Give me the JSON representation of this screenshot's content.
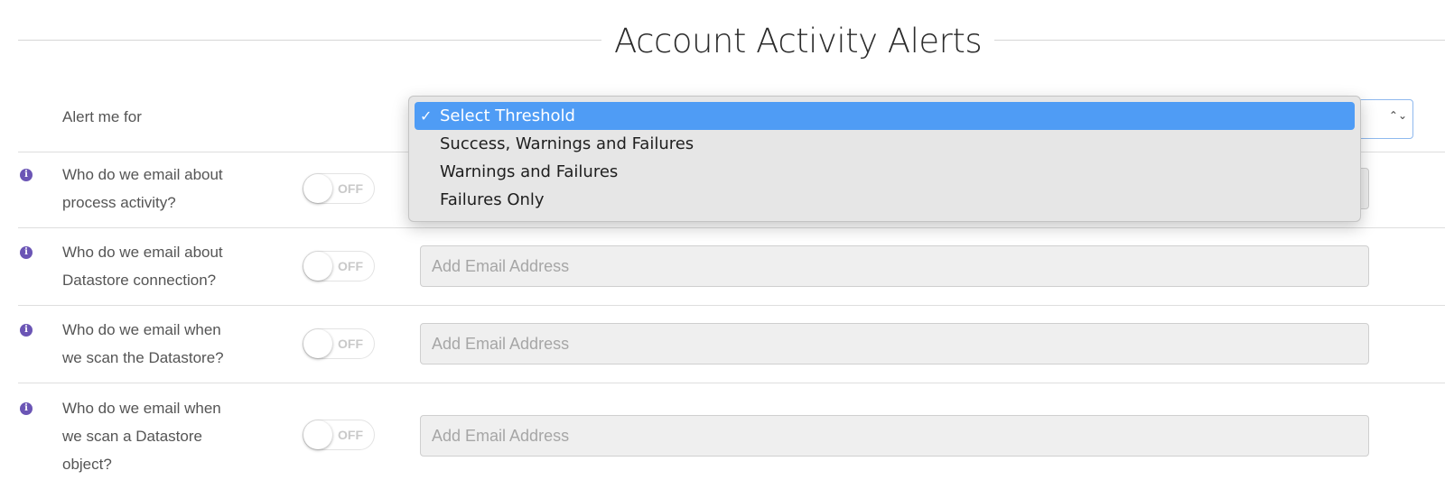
{
  "header": {
    "title": "Account Activity Alerts"
  },
  "threshold": {
    "label": "Alert me for",
    "selected_value": "Select Threshold",
    "options": [
      {
        "label": "Select Threshold",
        "selected": true,
        "check": "✓"
      },
      {
        "label": "Success, Warnings and Failures",
        "selected": false,
        "check": ""
      },
      {
        "label": "Warnings and Failures",
        "selected": false,
        "check": ""
      },
      {
        "label": "Failures Only",
        "selected": false,
        "check": ""
      }
    ]
  },
  "alerts": [
    {
      "lines": [
        "Who do we email about",
        "process activity?"
      ],
      "toggle_state": "OFF",
      "email_value": "",
      "email_placeholder": ""
    },
    {
      "lines": [
        "Who do we email about",
        "Datastore connection?"
      ],
      "toggle_state": "OFF",
      "email_value": "",
      "email_placeholder": "Add Email Address"
    },
    {
      "lines": [
        "Who do we email when",
        "we scan the Datastore?"
      ],
      "toggle_state": "OFF",
      "email_value": "",
      "email_placeholder": "Add Email Address"
    },
    {
      "lines": [
        "Who do we email when",
        "we scan a Datastore",
        "object?"
      ],
      "toggle_state": "OFF",
      "email_value": "",
      "email_placeholder": "Add Email Address"
    }
  ],
  "icons": {
    "info": "i",
    "chevron": "⌃⌄"
  },
  "colors": {
    "accent": "#4f9cf5",
    "info_icon": "#6b55b5",
    "input_bg": "#efefef"
  }
}
